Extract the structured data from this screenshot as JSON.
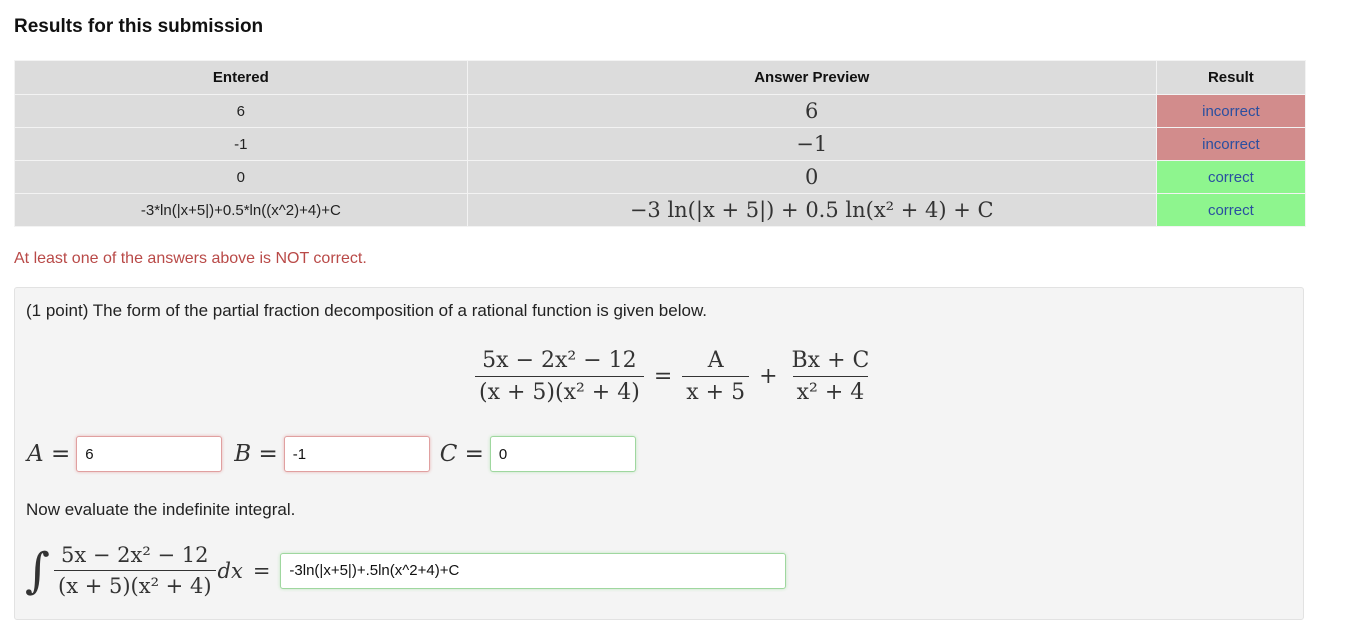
{
  "heading": "Results for this submission",
  "table": {
    "headers": [
      "Entered",
      "Answer Preview",
      "Result"
    ],
    "rows": [
      {
        "entered": "6",
        "preview": "6",
        "result": "incorrect",
        "status": "incorrect"
      },
      {
        "entered": "-1",
        "preview": "−1",
        "result": "incorrect",
        "status": "incorrect"
      },
      {
        "entered": "0",
        "preview": "0",
        "result": "correct",
        "status": "correct"
      },
      {
        "entered": "-3*ln(|x+5|)+0.5*ln((x^2)+4)+C",
        "preview": "−3 ln(|x + 5|) + 0.5 ln(x² + 4) + C",
        "result": "correct",
        "status": "correct"
      }
    ]
  },
  "warning": "At least one of the answers above is NOT correct.",
  "problem": {
    "intro": "(1 point) The form of the partial fraction decomposition of a rational function is given below.",
    "equation": {
      "lhs_numerator": "5x − 2x² − 12",
      "lhs_denominator": "(x + 5)(x² + 4)",
      "equals": "=",
      "term1_numerator": "A",
      "term1_denominator": "x + 5",
      "plus": "+",
      "term2_numerator": "Bx + C",
      "term2_denominator": "x² + 4"
    },
    "inputs": [
      {
        "label": "A",
        "value": "6",
        "status": "incorrect"
      },
      {
        "label": "B",
        "value": "-1",
        "status": "incorrect"
      },
      {
        "label": "C",
        "value": "0",
        "status": "correct"
      }
    ],
    "instruction": "Now evaluate the indefinite integral.",
    "integral": {
      "sign": "∫",
      "numerator": "5x − 2x² − 12",
      "denominator": "(x + 5)(x² + 4)",
      "dx": "dx",
      "equals": "=",
      "answer": "-3ln(|x+5|)+.5ln(x^2+4)+C",
      "status": "correct"
    }
  },
  "colors": {
    "incorrect_bg": "#d28c8c",
    "correct_bg": "#8ef58e",
    "result_text": "#2a4fa0",
    "warning": "#b94a48"
  }
}
